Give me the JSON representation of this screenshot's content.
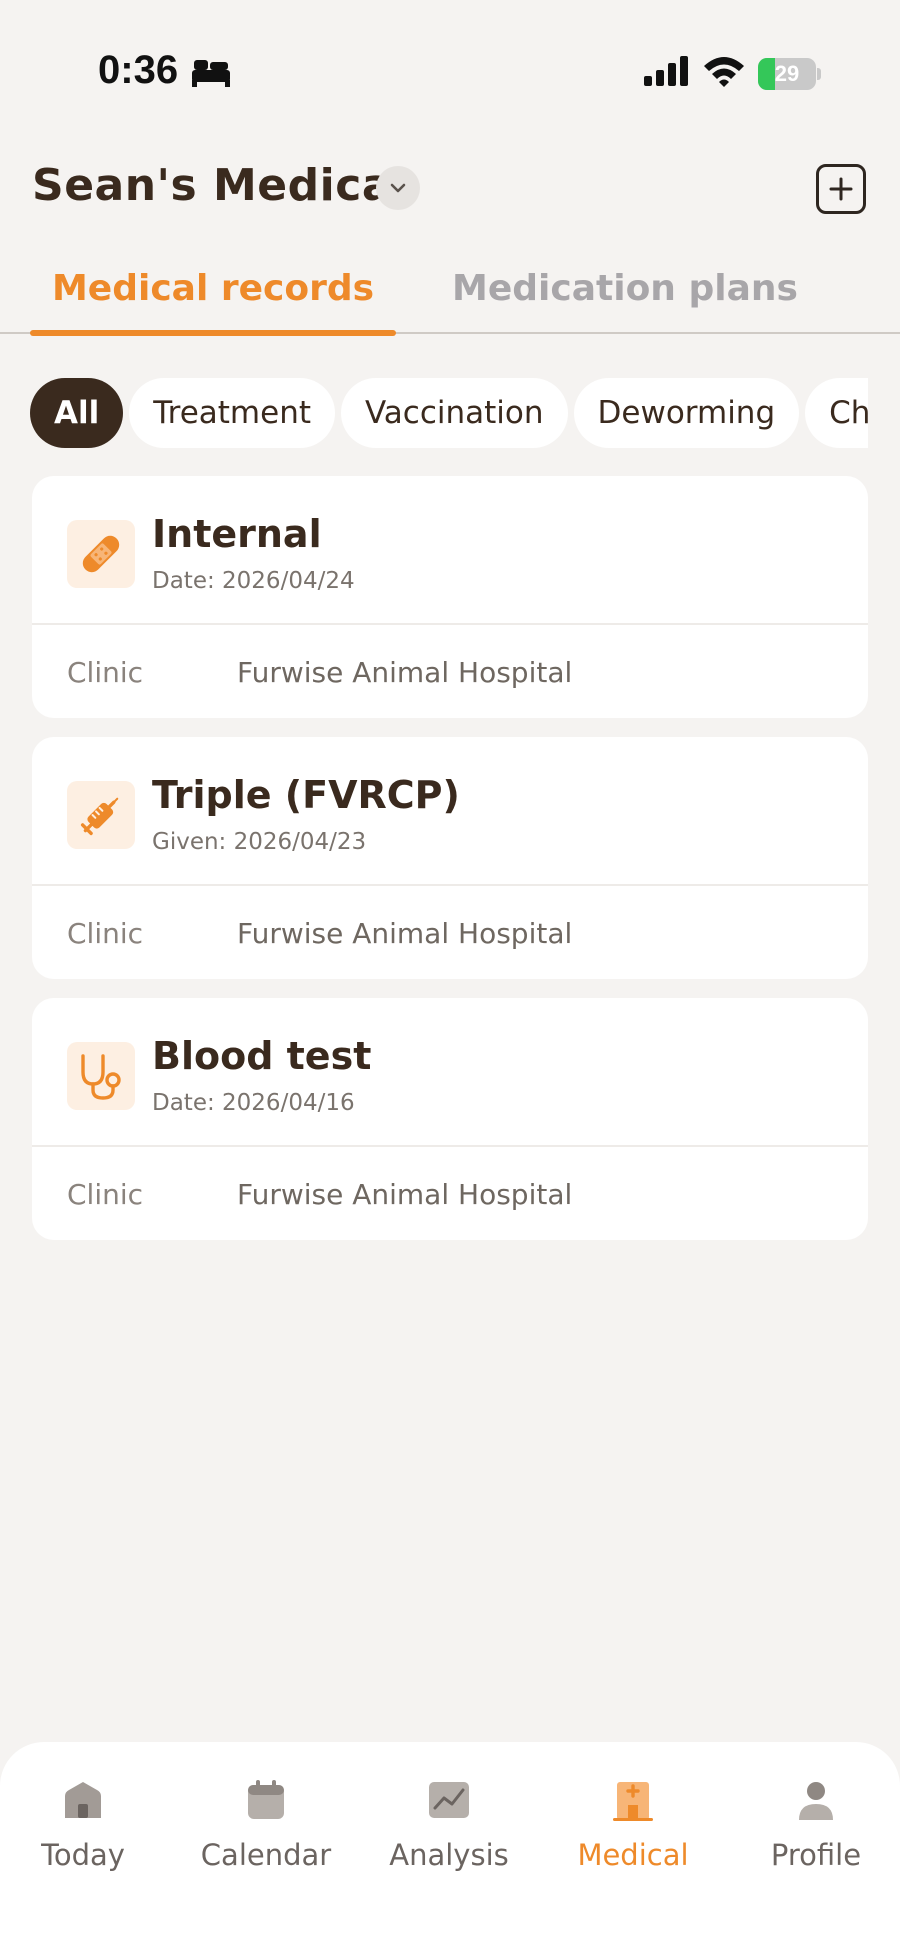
{
  "status_bar": {
    "time": "0:36",
    "battery": "29",
    "battery_level": 0.29
  },
  "header": {
    "title": "Sean's Medical"
  },
  "tabs": [
    {
      "label": "Medical records",
      "active": true
    },
    {
      "label": "Medication plans",
      "active": false
    }
  ],
  "filters": [
    {
      "label": "All",
      "active": true
    },
    {
      "label": "Treatment",
      "active": false
    },
    {
      "label": "Vaccination",
      "active": false
    },
    {
      "label": "Deworming",
      "active": false
    },
    {
      "label": "Che",
      "active": false
    }
  ],
  "records": [
    {
      "title": "Internal",
      "date": "Date: 2026/04/24",
      "clinic_label": "Clinic",
      "clinic": "Furwise Animal Hospital",
      "icon": "bandage-icon"
    },
    {
      "title": "Triple (FVRCP)",
      "date": "Given: 2026/04/23",
      "clinic_label": "Clinic",
      "clinic": "Furwise Animal Hospital",
      "icon": "syringe-icon"
    },
    {
      "title": "Blood test",
      "date": "Date: 2026/04/16",
      "clinic_label": "Clinic",
      "clinic": "Furwise Animal Hospital",
      "icon": "stethoscope-icon"
    }
  ],
  "nav": [
    {
      "label": "Today",
      "icon": "home-icon",
      "active": false
    },
    {
      "label": "Calendar",
      "icon": "calendar-icon",
      "active": false
    },
    {
      "label": "Analysis",
      "icon": "chart-icon",
      "active": false
    },
    {
      "label": "Medical",
      "icon": "hospital-icon",
      "active": true
    },
    {
      "label": "Profile",
      "icon": "person-icon",
      "active": false
    }
  ],
  "colors": {
    "accent": "#ee8a2a",
    "text_dark": "#3a2a1e",
    "background": "#f5f3f1",
    "icon_bg": "#fdefe2"
  }
}
